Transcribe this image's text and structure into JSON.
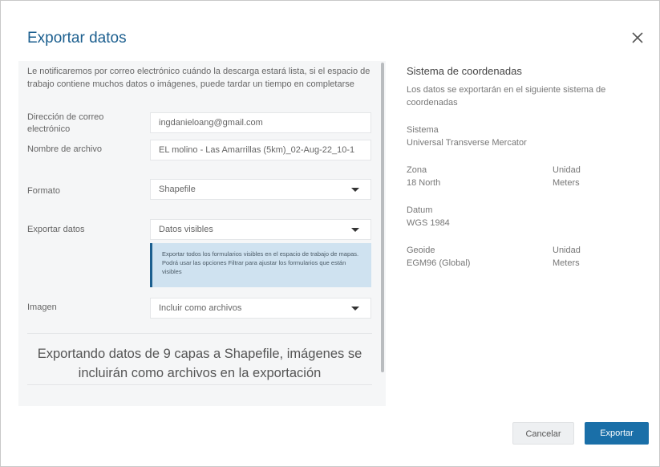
{
  "dialog": {
    "title": "Exportar datos",
    "close_icon": "close-icon"
  },
  "form": {
    "intro": "Le notificaremos por correo electrónico cuándo la descarga estará lista, si el espacio de trabajo contiene muchos datos o imágenes, puede tardar un tiempo en completarse",
    "email_label": "Dirección de correo electrónico",
    "email_value": "ingdanieloang@gmail.com",
    "filename_label": "Nombre de archivo",
    "filename_value": "EL molino - Las Amarrillas (5km)_02-Aug-22_10-1",
    "format_label": "Formato",
    "format_value": "Shapefile",
    "export_label": "Exportar datos",
    "export_value": "Datos visibles",
    "export_info": "Exportar todos los formularios visibles en el espacio de trabajo de mapas. Podrá usar las opciones Filtrar para ajustar los formularios que están visibles",
    "image_label": "Imagen",
    "image_value": "Incluir como archivos",
    "summary": "Exportando datos de 9 capas a Shapefile, imágenes se incluirán como archivos en la exportación"
  },
  "coords": {
    "title": "Sistema de coordenadas",
    "description": "Los datos se exportarán en el siguiente sistema de coordenadas",
    "system_label": "Sistema",
    "system_value": "Universal Transverse Mercator",
    "zone_label": "Zona",
    "zone_value": "18 North",
    "unit_label_1": "Unidad",
    "unit_value_1": "Meters",
    "datum_label": "Datum",
    "datum_value": "WGS 1984",
    "geoid_label": "Geoide",
    "geoid_value": "EGM96 (Global)",
    "unit_label_2": "Unidad",
    "unit_value_2": "Meters"
  },
  "buttons": {
    "cancel": "Cancelar",
    "export": "Exportar"
  },
  "colors": {
    "accent": "#1a6fa8",
    "title": "#1c5f8f",
    "info_bg": "#cfe2f0"
  }
}
